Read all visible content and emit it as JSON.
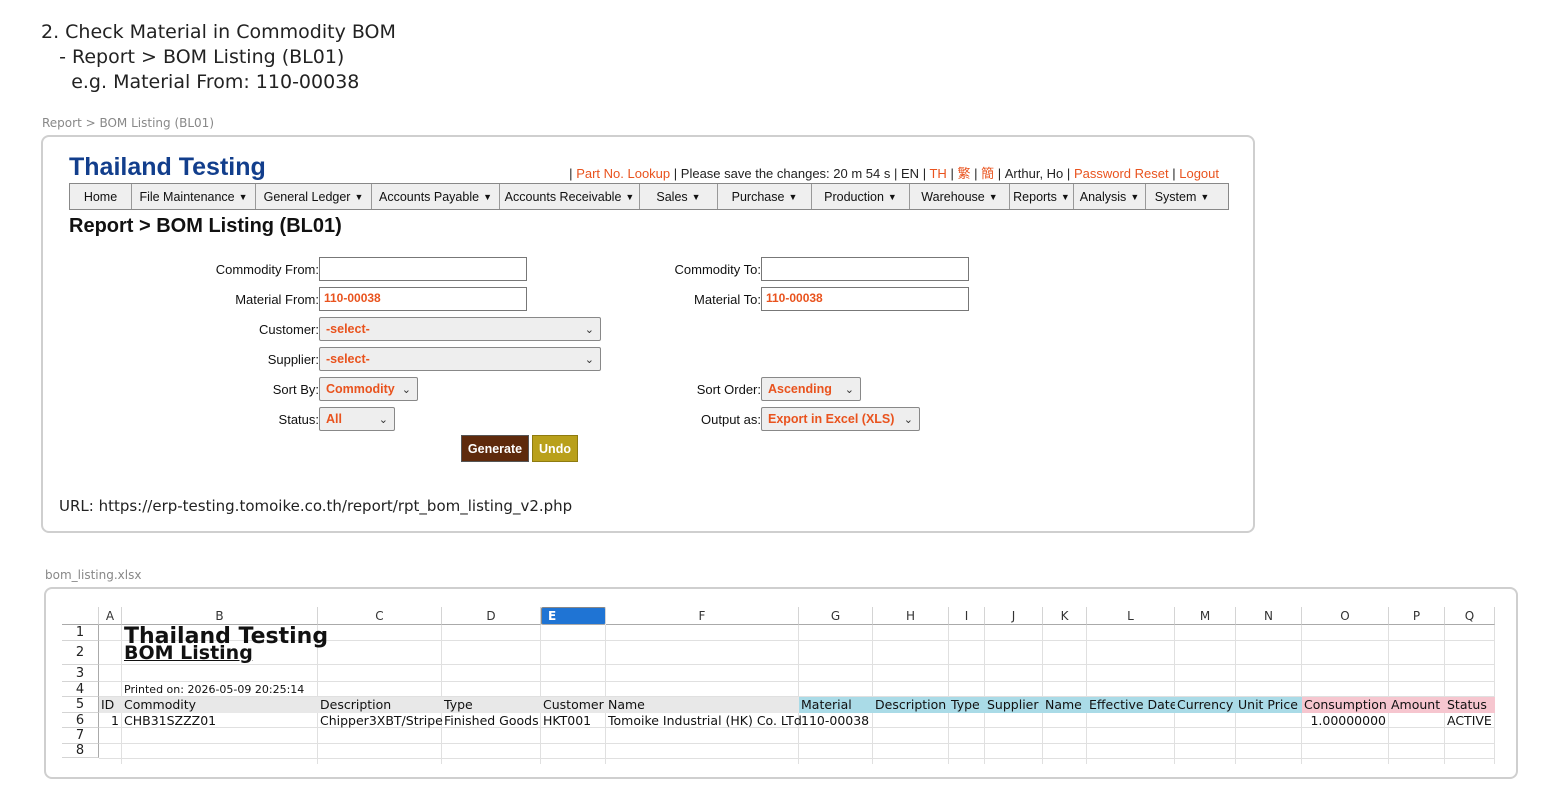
{
  "instructions": {
    "line1": "2. Check Material in Commodity BOM",
    "line2": "   - Report > BOM Listing (BL01)",
    "line3": "     e.g. Material From: 110-00038"
  },
  "caption_app": "Report > BOM Listing (BL01)",
  "caption_sheet": "bom_listing.xlsx",
  "app": {
    "title": "Thailand Testing",
    "topbar": {
      "sep": "|",
      "part_lookup": "Part No. Lookup",
      "save_msg": "Please save the changes: 20 m 54 s",
      "lang_en": "EN",
      "lang_th": "TH",
      "lang_tc": "繁",
      "lang_sc": "簡",
      "user": "Arthur, Ho",
      "password_reset": "Password Reset",
      "logout": "Logout"
    },
    "menu": [
      "Home",
      "File Maintenance",
      "General Ledger",
      "Accounts Payable",
      "Accounts Receivable",
      "Sales",
      "Purchase",
      "Production",
      "Warehouse",
      "Reports",
      "Analysis",
      "System"
    ],
    "page_title": "Report > BOM Listing (BL01)",
    "form": {
      "commodity_from_label": "Commodity From:",
      "commodity_from_value": "",
      "commodity_to_label": "Commodity To:",
      "commodity_to_value": "",
      "material_from_label": "Material From:",
      "material_from_value": "110-00038",
      "material_to_label": "Material To:",
      "material_to_value": "110-00038",
      "customer_label": "Customer:",
      "customer_value": "-select-",
      "supplier_label": "Supplier:",
      "supplier_value": "-select-",
      "sort_by_label": "Sort By:",
      "sort_by_value": "Commodity",
      "sort_order_label": "Sort Order:",
      "sort_order_value": "Ascending",
      "status_label": "Status:",
      "status_value": "All",
      "output_label": "Output as:",
      "output_value": "Export in Excel (XLS)",
      "generate": "Generate",
      "undo": "Undo"
    },
    "url_text": "URL: https://erp-testing.tomoike.co.th/report/rpt_bom_listing_v2.php"
  },
  "sheet": {
    "columns": [
      "A",
      "B",
      "C",
      "D",
      "E",
      "F",
      "G",
      "H",
      "I",
      "J",
      "K",
      "L",
      "M",
      "N",
      "O",
      "P",
      "Q"
    ],
    "selected_column": "E",
    "rows": [
      "1",
      "2",
      "3",
      "4",
      "5",
      "6",
      "7",
      "8"
    ],
    "title": "Thailand Testing",
    "subtitle": "BOM Listing",
    "printed_on": "Printed on: 2026-05-09 20:25:14",
    "headers": [
      "ID",
      "Commodity",
      "Description",
      "Type",
      "Customer",
      "Name",
      "Material",
      "Description",
      "Type",
      "Supplier",
      "Name",
      "Effective Date",
      "Currency",
      "Unit Price",
      "Consumption",
      "Amount",
      "Status"
    ],
    "data_row": [
      "1",
      "CHB31SZZZ01",
      "Chipper3XBT/Stripe",
      "Finished Goods",
      "HKT001",
      "Tomoike Industrial (HK) Co. LTd",
      "110-00038",
      "",
      "",
      "",
      "",
      "",
      "",
      "",
      "1.00000000",
      "",
      "ACTIVE"
    ],
    "header_colors": {
      "default": "#e8e8e8",
      "material": "#aadbe7",
      "consumption": "#f6c6cf"
    }
  }
}
